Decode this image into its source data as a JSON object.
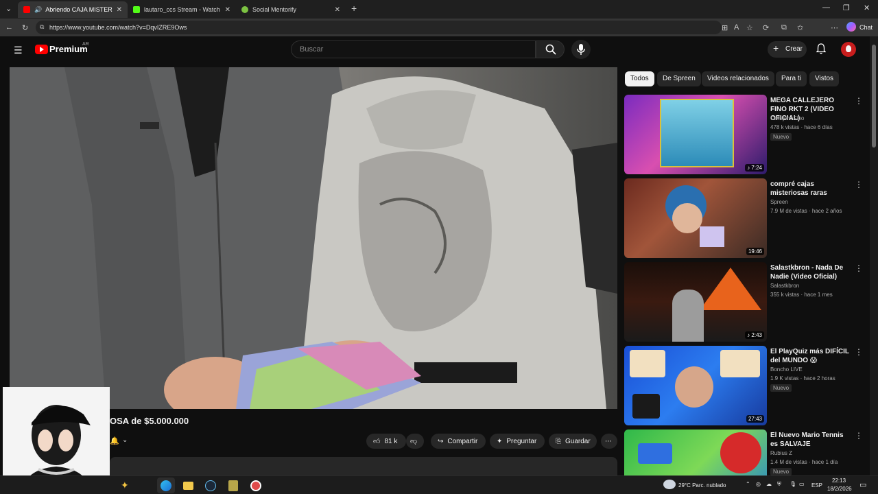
{
  "browser": {
    "tabs": [
      {
        "label": "Abriendo CAJA MISTERIOSA d",
        "favicon_color": "#ff0000"
      },
      {
        "label": "lautaro_ccs Stream - Watch Live o",
        "favicon_color": "#53fc18"
      },
      {
        "label": "Social Mentorify",
        "favicon_color": "#7cc242"
      }
    ],
    "url": "https://www.youtube.com/watch?v=DqvIZRE9Ows",
    "chat_label": "Chat"
  },
  "header": {
    "logo": "Premium",
    "region": "AR",
    "search_placeholder": "Buscar",
    "create_label": "Crear"
  },
  "chips": [
    "Todos",
    "De Spreen",
    "Videos relacionados",
    "Para ti",
    "Vistos"
  ],
  "video": {
    "title_partial": "OSA de $5.000.000",
    "likes": "81 k",
    "share": "Compartir",
    "ask": "Preguntar",
    "save": "Guardar"
  },
  "recommendations": [
    {
      "title": "MEGA CALLEJERO FINO RKT 2 (VIDEO OFICIAL)",
      "channel": "Callejero Fino",
      "meta": "478 k vistas · hace 6 días",
      "badge": "Nuevo",
      "duration": "♪ 7:24"
    },
    {
      "title": "compré cajas misteriosas raras",
      "channel": "Spreen",
      "meta": "7.9 M de vistas · hace 2 años",
      "badge": "",
      "duration": "19:46"
    },
    {
      "title": "Salastkbron - Nada De Nadie (Video Oficial)",
      "channel": "Salastkbron",
      "meta": "355 k vistas · hace 1 mes",
      "badge": "",
      "duration": "♪ 2:43"
    },
    {
      "title": "El PlayQuiz más DIFÍCIL del MUNDO 😱",
      "channel": "Boncho LIVE",
      "meta": "1.9 K vistas · hace 2 horas",
      "badge": "Nuevo",
      "duration": "27:43"
    },
    {
      "title": "El Nuevo Mario Tennis es SALVAJE",
      "channel": "Rubius Z",
      "meta": "1.4 M de vistas · hace 1 día",
      "badge": "Nuevo",
      "duration": ""
    }
  ],
  "taskbar": {
    "weather": "29°C  Parc. nublado",
    "lang": "ESP",
    "time": "22:13",
    "date": "18/2/2026"
  }
}
